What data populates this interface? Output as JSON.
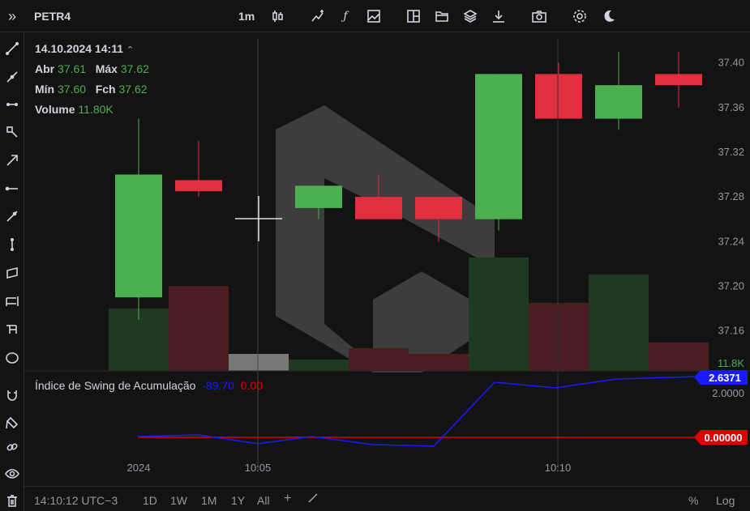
{
  "header": {
    "symbol": "PETR4",
    "interval": "1m",
    "tools": [
      "candles-icon",
      "indicator-icon",
      "function-icon",
      "image-icon",
      "layout-icon",
      "folder-icon",
      "layers-icon",
      "download-icon",
      "camera-icon",
      "gear-icon",
      "moon-icon"
    ]
  },
  "sidebar": {
    "menu_glyph": "»",
    "tools": [
      "trend-line-icon",
      "ray-icon",
      "horizontal-line-icon",
      "fib-icon",
      "arrow-icon",
      "horizontal-ray-icon",
      "extended-line-icon",
      "vertical-line-icon",
      "parallelogram-icon",
      "pitchfork-icon",
      "gann-icon",
      "circle-icon",
      "magnet-icon",
      "brush-icon",
      "link-icon",
      "eye-icon",
      "trash-icon"
    ]
  },
  "legend": {
    "datetime": "14.10.2024 14:11",
    "open_label": "Abr",
    "open": "37.61",
    "high_label": "Máx",
    "high": "37.62",
    "low_label": "Mín",
    "low": "37.60",
    "close_label": "Fch",
    "close": "37.62",
    "volume_label": "Volume",
    "volume": "11.80K"
  },
  "indicator": {
    "name": "Índice de Swing de Acumulação",
    "value1": "-89.70",
    "value2": "0.00",
    "last_value": "2.6371",
    "zero_value": "0.00000",
    "axis_label": "2.0000",
    "color_line": "#1a1aff",
    "color_zero": "#e00000"
  },
  "price_axis": {
    "labels": [
      "37.40",
      "37.36",
      "37.32",
      "37.28",
      "37.24",
      "37.20",
      "37.16"
    ],
    "volume_label": "11.8K"
  },
  "time_axis": {
    "labels": [
      "2024",
      "10:05",
      "10:10"
    ]
  },
  "bottom": {
    "time": "14:10:12 UTC−3",
    "ranges": [
      "1D",
      "1W",
      "1M",
      "1Y",
      "All"
    ],
    "percent": "%",
    "log": "Log"
  },
  "colors": {
    "up": "#4caf50",
    "down": "#e03040",
    "bg": "#131313"
  },
  "chart_data": {
    "type": "candlestick",
    "ylim": [
      37.13,
      37.42
    ],
    "candles": [
      {
        "open": 37.19,
        "close": 37.3,
        "high": 37.35,
        "low": 37.17,
        "volume_rel": 0.55
      },
      {
        "open": 37.295,
        "close": 37.285,
        "high": 37.33,
        "low": 37.28,
        "volume_rel": 0.75
      },
      {
        "open": 37.28,
        "close": 37.28,
        "high": 37.28,
        "low": 37.28,
        "volume_rel": 0.15
      },
      {
        "open": 37.27,
        "close": 37.29,
        "high": 37.29,
        "low": 37.26,
        "volume_rel": 0.1
      },
      {
        "open": 37.28,
        "close": 37.26,
        "high": 37.3,
        "low": 37.26,
        "volume_rel": 0.2
      },
      {
        "open": 37.28,
        "close": 37.26,
        "high": 37.28,
        "low": 37.24,
        "volume_rel": 0.15
      },
      {
        "open": 37.26,
        "close": 37.39,
        "high": 37.39,
        "low": 37.25,
        "volume_rel": 1.0
      },
      {
        "open": 37.39,
        "close": 37.35,
        "high": 37.4,
        "low": 37.35,
        "volume_rel": 0.6
      },
      {
        "open": 37.35,
        "close": 37.38,
        "high": 37.41,
        "low": 37.34,
        "volume_rel": 0.85
      },
      {
        "open": 37.39,
        "close": 37.38,
        "high": 37.41,
        "low": 37.36,
        "volume_rel": 0.25
      }
    ]
  }
}
